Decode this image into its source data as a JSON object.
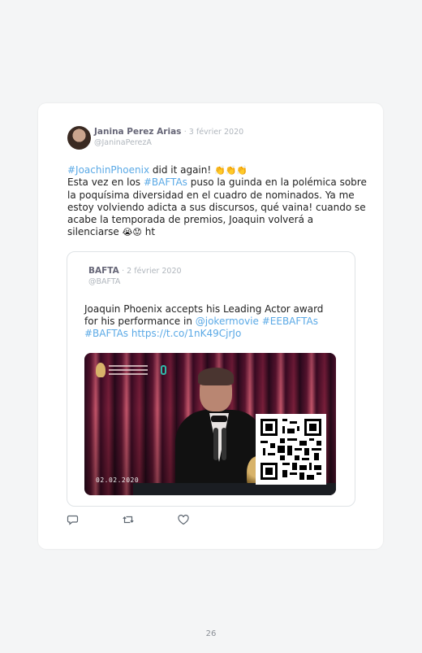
{
  "tweet": {
    "display_name": "Janina Perez Arias",
    "date": "3 février 2020",
    "handle": "@JaninaPerezA",
    "text_parts": {
      "tag1": "#JoachinPhoenix",
      "t1": " did it again! ",
      "emoji1": "👏👏👏",
      "t2": "Esta vez en los ",
      "tag2": "#BAFTAs",
      "t3": " puso la guinda en la polémica sobre la poquísima diversidad en el cuadro de nominados. Ya me estoy volviendo adicta a sus discursos, qué vaina! cuando se acabe la temporada de premios, Joaquin volverá a silenciarse ",
      "emoji2": "😭😟",
      "t4": " ht"
    }
  },
  "quoted": {
    "display_name": "BAFTA",
    "date": "2 février 2020",
    "handle": "@BAFTA",
    "text_parts": {
      "t1": "Joaquin Phoenix accepts his Leading Actor award for his performance in ",
      "tag1": "@jokermovie",
      "tag2": "#EEBAFTAs",
      "tag3": "#BAFTAs",
      "link": "https://t.co/1nK49CjrJo"
    },
    "video_date": "02.02.2020"
  },
  "actions": {
    "reply_icon": "reply-icon",
    "retweet_icon": "retweet-icon",
    "like_icon": "heart-icon"
  },
  "page_number": "26",
  "colors": {
    "link": "#5aa9e6",
    "muted": "#b0b6bd",
    "name": "#666677"
  }
}
